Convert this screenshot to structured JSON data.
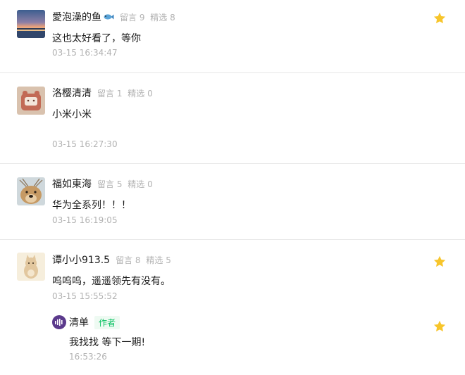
{
  "comments": [
    {
      "nickname": "愛泡澡的鱼",
      "stat_comments": "留言 9",
      "stat_featured": "精选 8",
      "text": "这也太好看了，等你",
      "time": "03-15 16:34:47",
      "starred": true,
      "avatar_icon": "sunset-avatar",
      "nickname_icon": "fish-icon"
    },
    {
      "nickname": "洛樱清清",
      "stat_comments": "留言 1",
      "stat_featured": "精选 0",
      "text": "小米小米",
      "time": "03-15 16:27:30",
      "starred": false,
      "avatar_icon": "plush-avatar"
    },
    {
      "nickname": "福如東海",
      "stat_comments": "留言 5",
      "stat_featured": "精选 0",
      "text": "华为全系列！！！",
      "time": "03-15 16:19:05",
      "starred": false,
      "avatar_icon": "dog-avatar"
    },
    {
      "nickname": "谭小小913.5",
      "stat_comments": "留言 8",
      "stat_featured": "精选 5",
      "text": "呜呜呜，遥遥领先有没有。",
      "time": "03-15 15:55:52",
      "starred": true,
      "avatar_icon": "cartoon-animal-avatar",
      "reply": {
        "author": "清单",
        "badge": "作者",
        "text": "我找找 等下一期!",
        "time": "16:53:26",
        "starred": true,
        "avatar_icon": "qingdan-logo-avatar"
      }
    }
  ],
  "colors": {
    "star": "#f7c52b",
    "meta": "#b2b2b2",
    "author_badge": "#07c160",
    "divider": "#e8e8e8"
  }
}
